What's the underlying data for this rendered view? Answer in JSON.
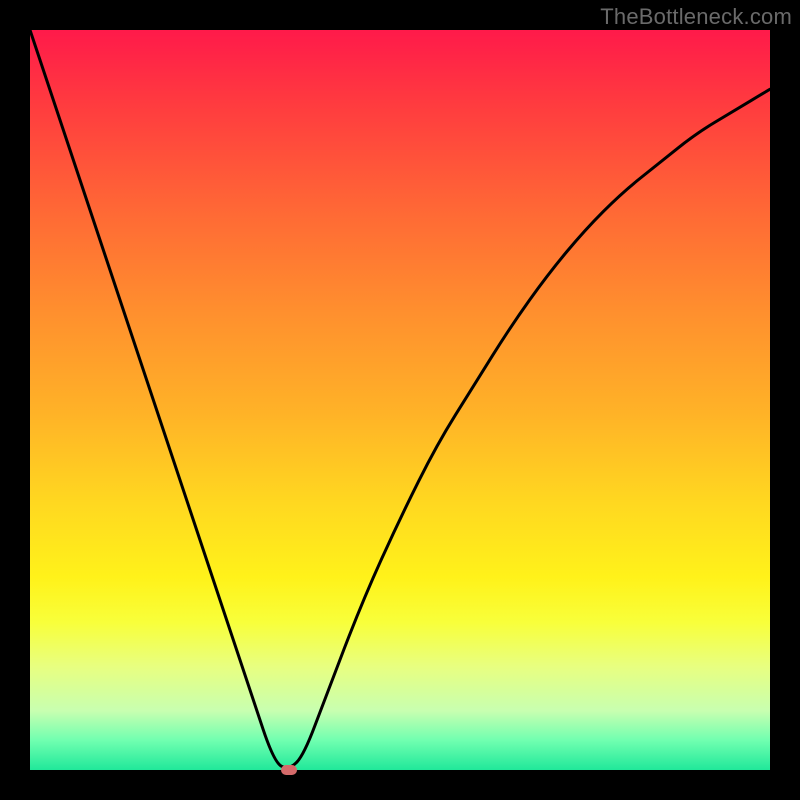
{
  "watermark": "TheBottleneck.com",
  "chart_data": {
    "type": "line",
    "title": "",
    "xlabel": "",
    "ylabel": "",
    "xlim": [
      0,
      100
    ],
    "ylim": [
      0,
      100
    ],
    "grid": false,
    "legend": false,
    "series": [
      {
        "name": "bottleneck-curve",
        "x": [
          0,
          5,
          10,
          15,
          20,
          25,
          30,
          33,
          35,
          37,
          40,
          45,
          50,
          55,
          60,
          65,
          70,
          75,
          80,
          85,
          90,
          95,
          100
        ],
        "y": [
          100,
          85,
          70,
          55,
          40,
          25,
          10,
          1,
          0,
          2,
          10,
          23,
          34,
          44,
          52,
          60,
          67,
          73,
          78,
          82,
          86,
          89,
          92
        ]
      }
    ],
    "marker": {
      "x": 35,
      "y": 0,
      "color": "#d46a6a"
    },
    "background_gradient": {
      "direction": "top-to-bottom",
      "stops": [
        {
          "pos": 0.0,
          "color": "#ff1a4a"
        },
        {
          "pos": 0.25,
          "color": "#ff6a35"
        },
        {
          "pos": 0.52,
          "color": "#ffb327"
        },
        {
          "pos": 0.74,
          "color": "#fff21a"
        },
        {
          "pos": 0.92,
          "color": "#c8ffb0"
        },
        {
          "pos": 1.0,
          "color": "#20e89a"
        }
      ]
    }
  }
}
